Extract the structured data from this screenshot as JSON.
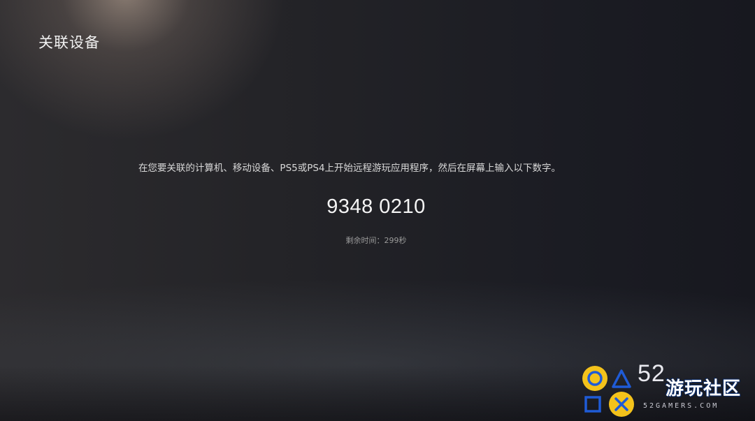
{
  "header": {
    "title": "关联设备"
  },
  "main": {
    "instruction": "在您要关联的计算机、移动设备、PS5或PS4上开始远程游玩应用程序，然后在屏幕上输入以下数字。",
    "code": "9348 0210",
    "time_remaining": "剩余时间：299秒"
  },
  "watermark": {
    "number": "52",
    "name": "游玩社区",
    "url": "52GAMERS.COM",
    "icons": [
      "circle-icon",
      "triangle-icon",
      "square-icon",
      "cross-icon"
    ],
    "colors": {
      "yellow": "#f3c21b",
      "blue": "#1f5bd6"
    }
  },
  "colors": {
    "background": "#1d1e24",
    "spotlight": "#d7beaa",
    "text_primary": "#f1f1f1",
    "text_secondary": "#9a9a9a"
  }
}
